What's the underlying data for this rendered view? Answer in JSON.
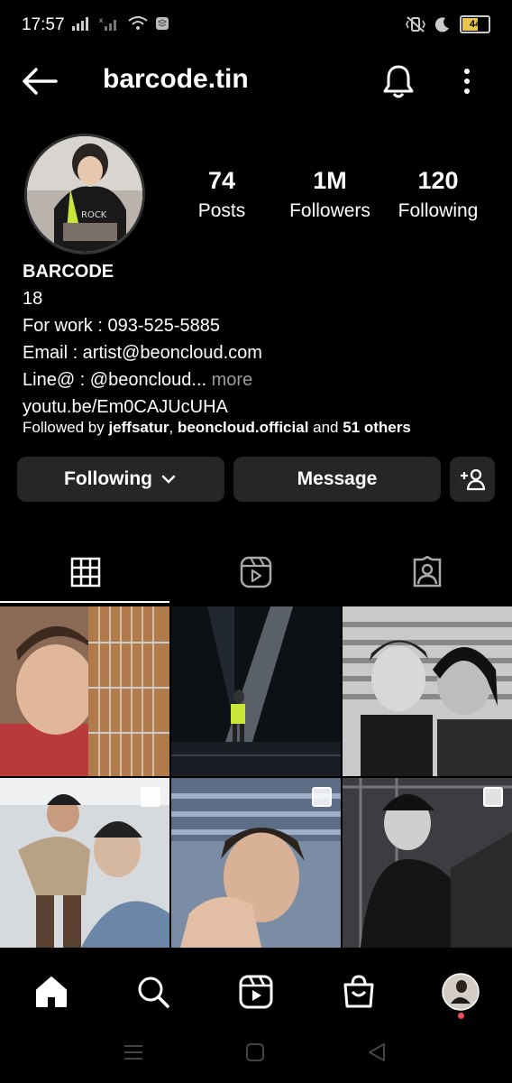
{
  "status_bar": {
    "time": "17:57",
    "battery": "44",
    "icons": [
      "signal-icon",
      "signal-no-sim-icon",
      "wifi-icon",
      "app-notification-icon",
      "vibrate-icon",
      "moon-icon",
      "battery-icon"
    ]
  },
  "header": {
    "username": "barcode.tin",
    "icons": [
      "back-arrow-icon",
      "bell-icon",
      "more-vertical-icon"
    ]
  },
  "profile": {
    "stats": [
      {
        "value": "74",
        "label": "Posts"
      },
      {
        "value": "1M",
        "label": "Followers"
      },
      {
        "value": "120",
        "label": "Following"
      }
    ],
    "bio": {
      "name": "BARCODE",
      "age": "18",
      "work": "For work : 093-525-5885",
      "email": "Email : artist@beoncloud.com",
      "line": "Line@ : @beoncloud...",
      "more": "more",
      "link": "youtu.be/Em0CAJUcUHA"
    },
    "followed_by": {
      "prefix": "Followed by ",
      "user1": "jeffsatur",
      "sep": ", ",
      "user2": "beoncloud.official",
      "mid": " and ",
      "others": "51 others"
    }
  },
  "actions": {
    "following": "Following",
    "message": "Message",
    "icons": [
      "chevron-down-icon",
      "add-person-icon"
    ]
  },
  "tabs": [
    "grid-icon",
    "reels-icon",
    "tagged-icon"
  ],
  "bottom_nav": [
    "home-icon",
    "search-icon",
    "reels-icon",
    "shop-icon",
    "profile-avatar"
  ]
}
